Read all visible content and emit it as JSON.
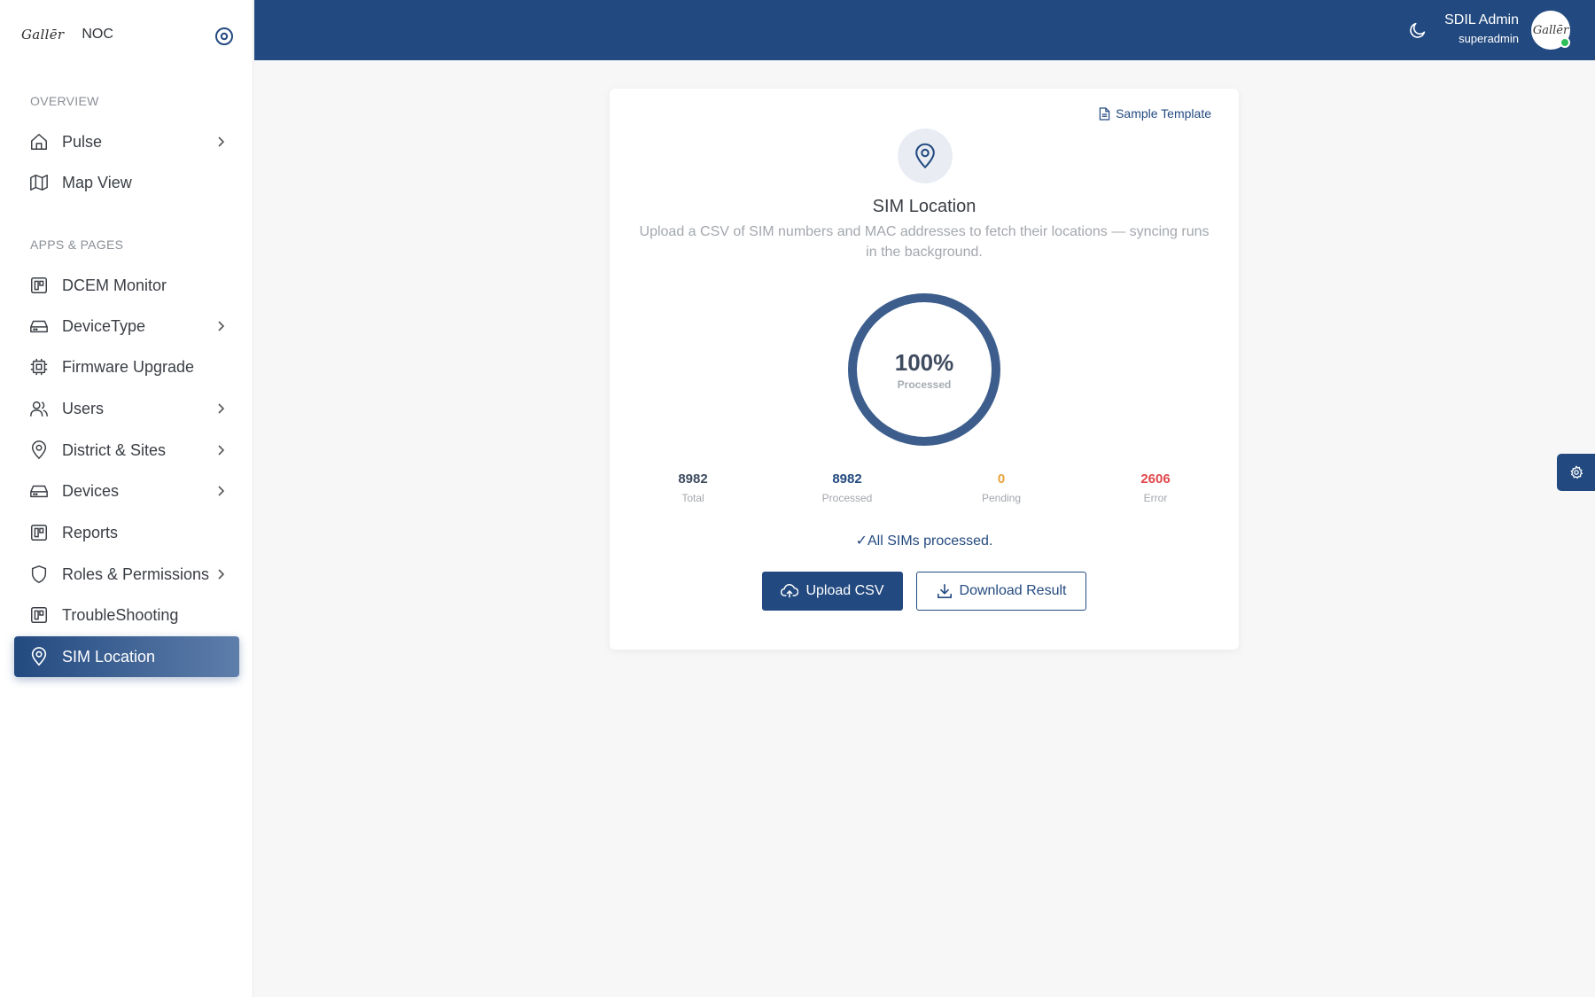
{
  "brand": {
    "logo_text": "Gallēr",
    "app_name": "NOC"
  },
  "sidebar": {
    "sections": [
      {
        "title": "OVERVIEW"
      },
      {
        "title": "APPS & PAGES"
      }
    ],
    "items": [
      {
        "label": "Pulse",
        "icon": "home-icon",
        "has_submenu": true
      },
      {
        "label": "Map View",
        "icon": "map-icon",
        "has_submenu": false
      },
      {
        "label": "DCEM Monitor",
        "icon": "board-icon",
        "has_submenu": false
      },
      {
        "label": "DeviceType",
        "icon": "device-icon",
        "has_submenu": true
      },
      {
        "label": "Firmware Upgrade",
        "icon": "chip-icon",
        "has_submenu": false
      },
      {
        "label": "Users",
        "icon": "users-icon",
        "has_submenu": true
      },
      {
        "label": "District & Sites",
        "icon": "location-pin-icon",
        "has_submenu": true
      },
      {
        "label": "Devices",
        "icon": "device-icon",
        "has_submenu": true
      },
      {
        "label": "Reports",
        "icon": "board-icon",
        "has_submenu": false
      },
      {
        "label": "Roles & Permissions",
        "icon": "shield-icon",
        "has_submenu": true
      },
      {
        "label": "TroubleShooting",
        "icon": "board-icon",
        "has_submenu": false
      },
      {
        "label": "SIM Location",
        "icon": "location-pin-icon",
        "has_submenu": false,
        "active": true
      }
    ]
  },
  "topbar": {
    "user_name": "SDIL Admin",
    "user_role": "superadmin",
    "avatar_text": "Gallēr",
    "theme_icon": "moon-icon"
  },
  "card": {
    "sample_template_label": "Sample Template",
    "title": "SIM Location",
    "description": "Upload a CSV of SIM numbers and MAC addresses to fetch their locations — syncing runs in the background.",
    "progress": {
      "percent_text": "100%",
      "label": "Processed",
      "fraction": 1.0
    },
    "stats": [
      {
        "value": "8982",
        "label": "Total",
        "color": "#3f4b5f"
      },
      {
        "value": "8982",
        "label": "Processed",
        "color": "#234a80"
      },
      {
        "value": "0",
        "label": "Pending",
        "color": "#e8a13a"
      },
      {
        "value": "2606",
        "label": "Error",
        "color": "#e0474c"
      }
    ],
    "status_message": "✓All SIMs processed.",
    "upload_button": "Upload CSV",
    "download_button": "Download Result"
  },
  "colors": {
    "primary": "#234a80",
    "ring_track": "#dfe5ee",
    "online": "#2fbf5a"
  }
}
